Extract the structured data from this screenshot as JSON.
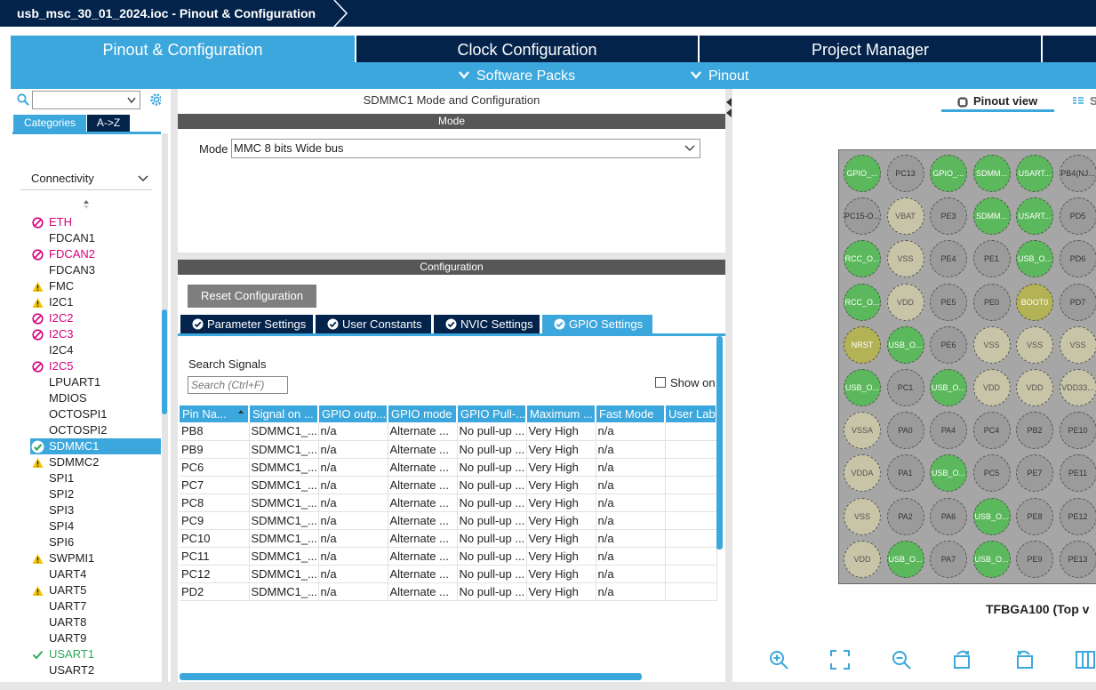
{
  "app": {
    "title": "usb_msc_30_01_2024.ioc - Pinout & Configuration"
  },
  "colors": {
    "navy": "#03234b",
    "accent": "#3ca7dc",
    "error": "#d6007e",
    "warning": "#f2c200",
    "ok": "#2eab5c"
  },
  "main_tabs": [
    {
      "label": "Pinout & Configuration",
      "active": true
    },
    {
      "label": "Clock Configuration",
      "active": false
    },
    {
      "label": "Project Manager",
      "active": false
    }
  ],
  "sub_menu": {
    "software_packs": "Software Packs",
    "pinout": "Pinout"
  },
  "left": {
    "category_tabs": {
      "categories": "Categories",
      "az": "A->Z"
    },
    "section": "Connectivity",
    "items": [
      {
        "label": "ETH",
        "status": "error"
      },
      {
        "label": "FDCAN1",
        "status": "none"
      },
      {
        "label": "FDCAN2",
        "status": "error"
      },
      {
        "label": "FDCAN3",
        "status": "none"
      },
      {
        "label": "FMC",
        "status": "warning"
      },
      {
        "label": "I2C1",
        "status": "warning"
      },
      {
        "label": "I2C2",
        "status": "error"
      },
      {
        "label": "I2C3",
        "status": "error"
      },
      {
        "label": "I2C4",
        "status": "none"
      },
      {
        "label": "I2C5",
        "status": "error"
      },
      {
        "label": "LPUART1",
        "status": "none"
      },
      {
        "label": "MDIOS",
        "status": "none"
      },
      {
        "label": "OCTOSPI1",
        "status": "none"
      },
      {
        "label": "OCTOSPI2",
        "status": "none"
      },
      {
        "label": "SDMMC1",
        "status": "selected"
      },
      {
        "label": "SDMMC2",
        "status": "warning"
      },
      {
        "label": "SPI1",
        "status": "none"
      },
      {
        "label": "SPI2",
        "status": "none"
      },
      {
        "label": "SPI3",
        "status": "none"
      },
      {
        "label": "SPI4",
        "status": "none"
      },
      {
        "label": "SPI6",
        "status": "none"
      },
      {
        "label": "SWPMI1",
        "status": "warning"
      },
      {
        "label": "UART4",
        "status": "none"
      },
      {
        "label": "UART5",
        "status": "warning"
      },
      {
        "label": "UART7",
        "status": "none"
      },
      {
        "label": "UART8",
        "status": "none"
      },
      {
        "label": "UART9",
        "status": "none"
      },
      {
        "label": "USART1",
        "status": "ok"
      },
      {
        "label": "USART2",
        "status": "none"
      }
    ]
  },
  "center": {
    "title": "SDMMC1 Mode and Configuration",
    "mode_header": "Mode",
    "mode_label": "Mode",
    "mode_value": "MMC 8 bits Wide bus",
    "config_header": "Configuration",
    "reset_button": "Reset Configuration",
    "settings_tabs": [
      {
        "label": "Parameter Settings",
        "active": false
      },
      {
        "label": "User Constants",
        "active": false
      },
      {
        "label": "NVIC Settings",
        "active": false
      },
      {
        "label": "GPIO Settings",
        "active": true
      }
    ],
    "search_label": "Search Signals",
    "search_placeholder": "Search (Ctrl+F)",
    "show_only": "Show on",
    "table": {
      "headers": [
        "Pin Na...",
        "Signal on ...",
        "GPIO outp...",
        "GPIO mode",
        "GPIO Pull-...",
        "Maximum ...",
        "Fast Mode",
        "User Lab"
      ],
      "rows": [
        [
          "PB8",
          "SDMMC1_...",
          "n/a",
          "Alternate ...",
          "No pull-up ...",
          "Very High",
          "n/a",
          ""
        ],
        [
          "PB9",
          "SDMMC1_...",
          "n/a",
          "Alternate ...",
          "No pull-up ...",
          "Very High",
          "n/a",
          ""
        ],
        [
          "PC6",
          "SDMMC1_...",
          "n/a",
          "Alternate ...",
          "No pull-up ...",
          "Very High",
          "n/a",
          ""
        ],
        [
          "PC7",
          "SDMMC1_...",
          "n/a",
          "Alternate ...",
          "No pull-up ...",
          "Very High",
          "n/a",
          ""
        ],
        [
          "PC8",
          "SDMMC1_...",
          "n/a",
          "Alternate ...",
          "No pull-up ...",
          "Very High",
          "n/a",
          ""
        ],
        [
          "PC9",
          "SDMMC1_...",
          "n/a",
          "Alternate ...",
          "No pull-up ...",
          "Very High",
          "n/a",
          ""
        ],
        [
          "PC10",
          "SDMMC1_...",
          "n/a",
          "Alternate ...",
          "No pull-up ...",
          "Very High",
          "n/a",
          ""
        ],
        [
          "PC11",
          "SDMMC1_...",
          "n/a",
          "Alternate ...",
          "No pull-up ...",
          "Very High",
          "n/a",
          ""
        ],
        [
          "PC12",
          "SDMMC1_...",
          "n/a",
          "Alternate ...",
          "No pull-up ...",
          "Very High",
          "n/a",
          ""
        ],
        [
          "PD2",
          "SDMMC1_...",
          "n/a",
          "Alternate ...",
          "No pull-up ...",
          "Very High",
          "n/a",
          ""
        ]
      ]
    }
  },
  "right": {
    "pinout_view": "Pinout view",
    "system_view": "S",
    "package": "TFBGA100 (Top v",
    "ball_colors": {
      "green": "#5cb85c",
      "grey": "#9b9b9b",
      "beige": "#c8c4a8",
      "olive": "#b3b355"
    },
    "pins": [
      [
        {
          "label": "GPIO_...",
          "color": "green"
        },
        {
          "label": "PC13",
          "color": "grey"
        },
        {
          "label": "GPIO_...",
          "color": "green"
        },
        {
          "label": "SDMM...",
          "color": "green"
        },
        {
          "label": "USART...",
          "color": "green"
        },
        {
          "label": "PB4(NJ...",
          "color": "grey"
        }
      ],
      [
        {
          "label": "PC15-O...",
          "color": "grey"
        },
        {
          "label": "VBAT",
          "color": "beige"
        },
        {
          "label": "PE3",
          "color": "grey"
        },
        {
          "label": "SDMM...",
          "color": "green"
        },
        {
          "label": "USART...",
          "color": "green"
        },
        {
          "label": "PD5",
          "color": "grey"
        }
      ],
      [
        {
          "label": "RCC_O...",
          "color": "green"
        },
        {
          "label": "VSS",
          "color": "beige"
        },
        {
          "label": "PE4",
          "color": "grey"
        },
        {
          "label": "PE1",
          "color": "grey"
        },
        {
          "label": "USB_O...",
          "color": "green"
        },
        {
          "label": "PD6",
          "color": "grey"
        }
      ],
      [
        {
          "label": "RCC_O...",
          "color": "green"
        },
        {
          "label": "VDD",
          "color": "beige"
        },
        {
          "label": "PE5",
          "color": "grey"
        },
        {
          "label": "PE0",
          "color": "grey"
        },
        {
          "label": "BOOT0",
          "color": "olive"
        },
        {
          "label": "PD7",
          "color": "grey"
        }
      ],
      [
        {
          "label": "NRST",
          "color": "olive"
        },
        {
          "label": "USB_O...",
          "color": "green"
        },
        {
          "label": "PE6",
          "color": "grey"
        },
        {
          "label": "VSS",
          "color": "beige"
        },
        {
          "label": "VSS",
          "color": "beige"
        },
        {
          "label": "VSS",
          "color": "beige"
        }
      ],
      [
        {
          "label": "USB_O...",
          "color": "green"
        },
        {
          "label": "PC1",
          "color": "grey"
        },
        {
          "label": "USB_O...",
          "color": "green"
        },
        {
          "label": "VDD",
          "color": "beige"
        },
        {
          "label": "VDD",
          "color": "beige"
        },
        {
          "label": "VDD33...",
          "color": "beige"
        }
      ],
      [
        {
          "label": "VSSA",
          "color": "beige"
        },
        {
          "label": "PA0",
          "color": "grey"
        },
        {
          "label": "PA4",
          "color": "grey"
        },
        {
          "label": "PC4",
          "color": "grey"
        },
        {
          "label": "PB2",
          "color": "grey"
        },
        {
          "label": "PE10",
          "color": "grey"
        }
      ],
      [
        {
          "label": "VDDA",
          "color": "beige"
        },
        {
          "label": "PA1",
          "color": "grey"
        },
        {
          "label": "USB_O...",
          "color": "green"
        },
        {
          "label": "PC5",
          "color": "grey"
        },
        {
          "label": "PE7",
          "color": "grey"
        },
        {
          "label": "PE11",
          "color": "grey"
        }
      ],
      [
        {
          "label": "VSS",
          "color": "beige"
        },
        {
          "label": "PA2",
          "color": "grey"
        },
        {
          "label": "PA6",
          "color": "grey"
        },
        {
          "label": "USB_O...",
          "color": "green"
        },
        {
          "label": "PE8",
          "color": "grey"
        },
        {
          "label": "PE12",
          "color": "grey"
        }
      ],
      [
        {
          "label": "VDD",
          "color": "beige"
        },
        {
          "label": "USB_O...",
          "color": "green"
        },
        {
          "label": "PA7",
          "color": "grey"
        },
        {
          "label": "USB_O...",
          "color": "green"
        },
        {
          "label": "PE9",
          "color": "grey"
        },
        {
          "label": "PE13",
          "color": "grey"
        }
      ]
    ],
    "tools": [
      "zoom-in-icon",
      "fit-screen-icon",
      "zoom-out-icon",
      "rotate-right-icon",
      "rotate-left-icon",
      "split-view-icon"
    ]
  }
}
